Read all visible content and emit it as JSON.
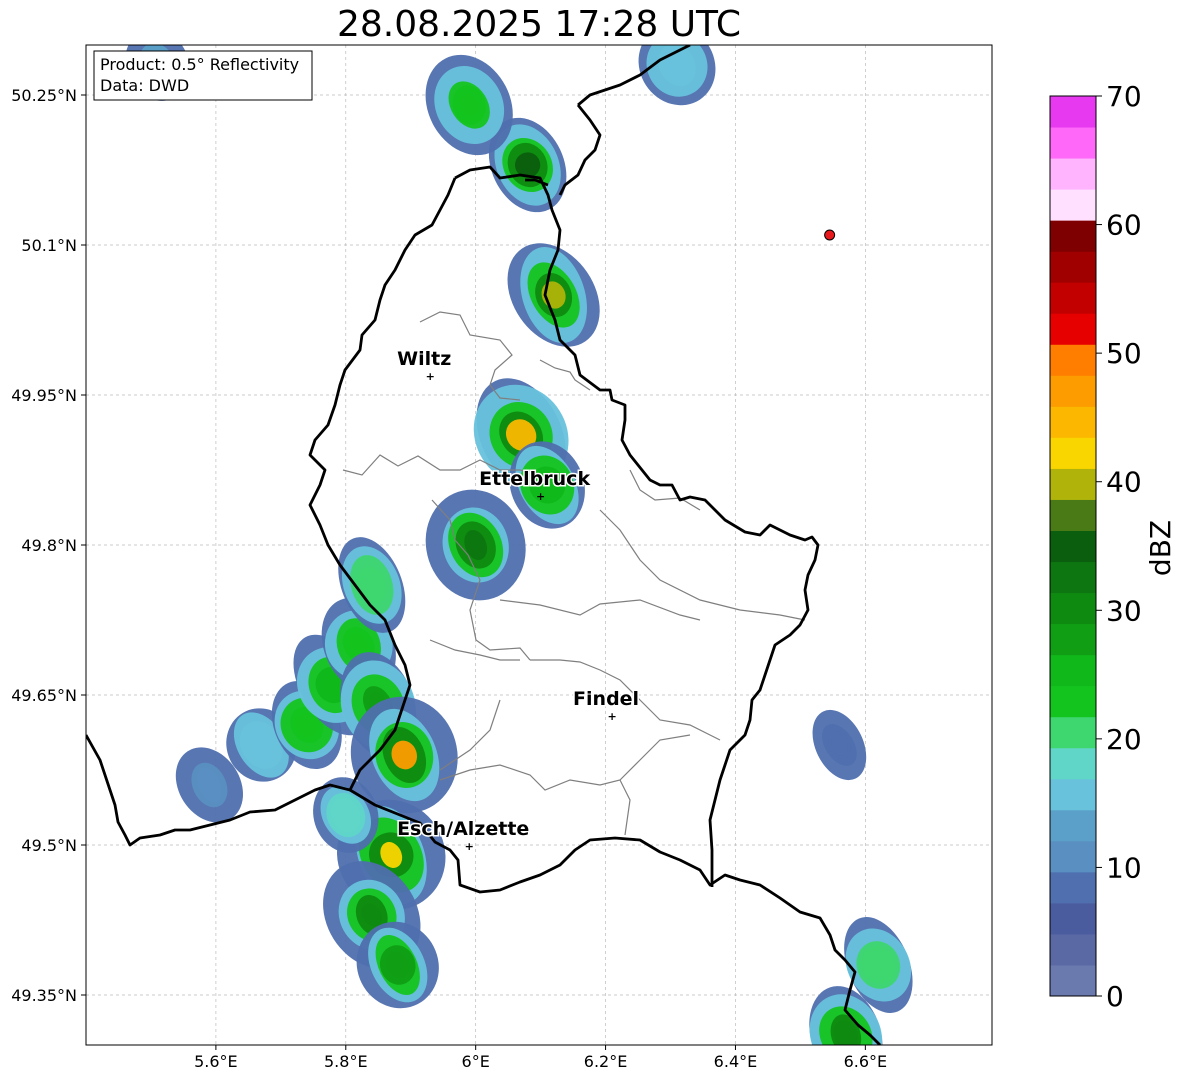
{
  "title": "28.08.2025 17:28 UTC",
  "info_box": {
    "product": "Product: 0.5° Reflectivity",
    "data": "Data: DWD"
  },
  "map": {
    "lon_range": [
      5.4,
      6.795
    ],
    "lat_range": [
      49.3,
      50.3
    ],
    "lon_ticks": [
      {
        "value": 5.6,
        "label": "5.6°E"
      },
      {
        "value": 5.8,
        "label": "5.8°E"
      },
      {
        "value": 6.0,
        "label": "6°E"
      },
      {
        "value": 6.2,
        "label": "6.2°E"
      },
      {
        "value": 6.4,
        "label": "6.4°E"
      },
      {
        "value": 6.6,
        "label": "6.6°E"
      }
    ],
    "lat_ticks": [
      {
        "value": 50.25,
        "label": "50.25°N"
      },
      {
        "value": 50.1,
        "label": "50.1°N"
      },
      {
        "value": 49.95,
        "label": "49.95°N"
      },
      {
        "value": 49.8,
        "label": "49.8°N"
      },
      {
        "value": 49.65,
        "label": "49.65°N"
      },
      {
        "value": 49.5,
        "label": "49.5°N"
      },
      {
        "value": 49.35,
        "label": "49.35°N"
      }
    ],
    "gridlines": true,
    "cities": [
      {
        "name": "Wiltz",
        "lon": 5.93,
        "lat": 49.97
      },
      {
        "name": "Ettelbruck",
        "lon": 6.1,
        "lat": 49.85
      },
      {
        "name": "Findel",
        "lon": 6.21,
        "lat": 49.63
      },
      {
        "name": "Esch/Alzette",
        "lon": 5.99,
        "lat": 49.5
      }
    ],
    "marker": {
      "lon": 6.545,
      "lat": 50.11,
      "color": "#e8191c"
    }
  },
  "colorbar": {
    "label": "dBZ",
    "min": 0,
    "max": 70,
    "tick_values": [
      0,
      10,
      20,
      30,
      40,
      50,
      60,
      70
    ],
    "colors": [
      "#6a79ae",
      "#5a68a4",
      "#4a5c9e",
      "#4f6fae",
      "#5a8fc2",
      "#5aa0c8",
      "#68c2dc",
      "#5fd6c8",
      "#3ed66f",
      "#14c41e",
      "#10b81a",
      "#109e14",
      "#0e8a10",
      "#0d7610",
      "#0b5e0d",
      "#4a7a16",
      "#b0b40a",
      "#fad600",
      "#fcb800",
      "#fd9c00",
      "#ff7e00",
      "#e70000",
      "#c20000",
      "#a10000",
      "#7e0000",
      "#ffe0fe",
      "#ffb4fd",
      "#ff68f8",
      "#e73af0"
    ]
  },
  "radar_cells": [
    {
      "lon": 5.59,
      "lat": 49.56,
      "dbz": 12
    },
    {
      "lon": 5.67,
      "lat": 49.6,
      "dbz": 16
    },
    {
      "lon": 5.74,
      "lat": 49.62,
      "dbz": 23
    },
    {
      "lon": 5.78,
      "lat": 49.66,
      "dbz": 26
    },
    {
      "lon": 5.82,
      "lat": 49.7,
      "dbz": 22
    },
    {
      "lon": 5.85,
      "lat": 49.64,
      "dbz": 28
    },
    {
      "lon": 5.89,
      "lat": 49.59,
      "dbz": 46
    },
    {
      "lon": 5.87,
      "lat": 49.49,
      "dbz": 42
    },
    {
      "lon": 5.84,
      "lat": 49.43,
      "dbz": 30
    },
    {
      "lon": 5.88,
      "lat": 49.38,
      "dbz": 27
    },
    {
      "lon": 5.8,
      "lat": 49.53,
      "dbz": 18
    },
    {
      "lon": 5.84,
      "lat": 49.76,
      "dbz": 20
    },
    {
      "lon": 6.0,
      "lat": 49.8,
      "dbz": 33
    },
    {
      "lon": 6.07,
      "lat": 49.91,
      "dbz": 45
    },
    {
      "lon": 6.11,
      "lat": 49.86,
      "dbz": 26
    },
    {
      "lon": 6.08,
      "lat": 50.18,
      "dbz": 34
    },
    {
      "lon": 6.12,
      "lat": 50.05,
      "dbz": 39
    },
    {
      "lon": 5.99,
      "lat": 50.24,
      "dbz": 22
    },
    {
      "lon": 6.62,
      "lat": 49.38,
      "dbz": 20
    },
    {
      "lon": 6.57,
      "lat": 49.31,
      "dbz": 30
    },
    {
      "lon": 6.31,
      "lat": 50.28,
      "dbz": 16
    },
    {
      "lon": 5.51,
      "lat": 50.28,
      "dbz": 14
    },
    {
      "lon": 6.56,
      "lat": 49.6,
      "dbz": 9
    }
  ]
}
